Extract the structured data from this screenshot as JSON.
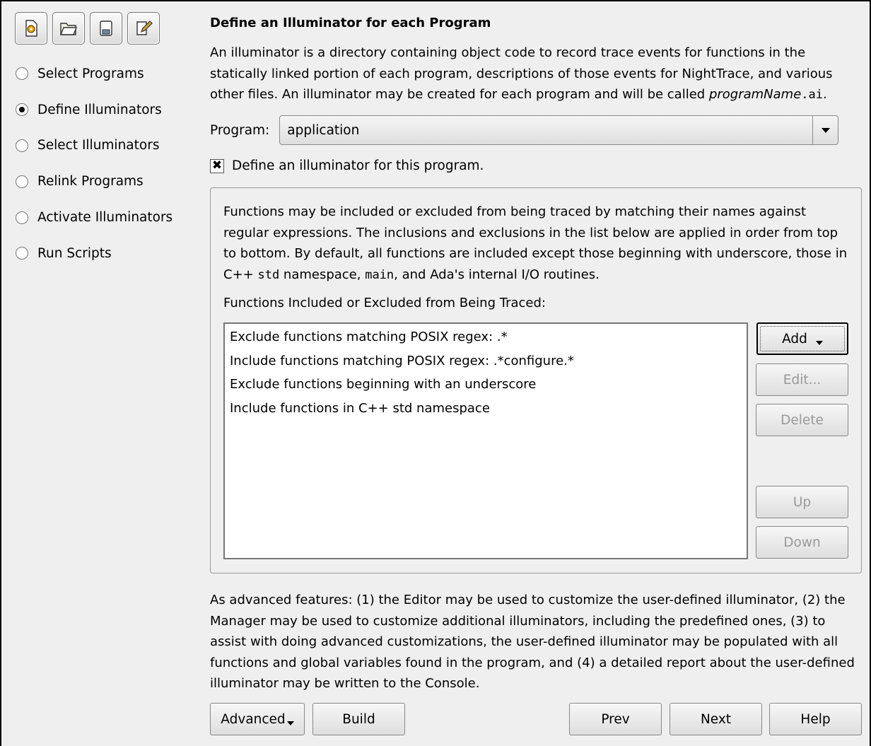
{
  "toolbar": {
    "buttons": [
      {
        "icon": "new-gear-icon"
      },
      {
        "icon": "open-folder-icon"
      },
      {
        "icon": "save-disk-icon"
      },
      {
        "icon": "edit-icon"
      }
    ]
  },
  "steps": [
    {
      "label": "Select Programs",
      "selected": false
    },
    {
      "label": "Define Illuminators",
      "selected": true
    },
    {
      "label": "Select Illuminators",
      "selected": false
    },
    {
      "label": "Relink Programs",
      "selected": false
    },
    {
      "label": "Activate Illuminators",
      "selected": false
    },
    {
      "label": "Run Scripts",
      "selected": false
    }
  ],
  "main": {
    "title": "Define an Illuminator for each Program",
    "intro_text": "An illuminator is a directory containing object code to record trace events for functions in the statically linked portion of each program, descriptions of those events for NightTrace, and various other files. An illuminator may be created for each program and will be called ",
    "intro_italic": "programName",
    "intro_mono": ".ai",
    "intro_end": ".",
    "program_label": "Program:",
    "program_value": "application",
    "define_checkbox_label": "Define an illuminator for this program.",
    "define_checked": true,
    "define_check_mark": "✖",
    "desc_part1": "Functions may be included or excluded from being traced by matching their names against regular expressions. The inclusions and exclusions in the list below are applied in order from top to bottom. By default, all functions are included except those beginning with underscore, those in C++ ",
    "desc_mono1": "std",
    "desc_part2": " namespace, ",
    "desc_mono2": "main",
    "desc_part3": ", and Ada's internal I/O routines.",
    "list_label": "Functions Included or Excluded from Being Traced:",
    "list_items": [
      "Exclude functions matching POSIX regex: .*",
      "Include functions matching POSIX regex: .*configure.*",
      "Exclude functions beginning with an underscore",
      "Include functions in C++ std namespace"
    ],
    "add_label": "Add",
    "edit_label": "Edit...",
    "delete_label": "Delete",
    "up_label": "Up",
    "down_label": "Down",
    "advanced_text": "As advanced features: (1) the Editor may be used to customize the user-defined illuminator, (2) the Manager may be used to customize additional illuminators, including the predefined ones, (3) to assist with doing advanced customizations, the user-defined illuminator may be populated with all functions and global variables found in the program, and (4) a detailed report about the user-defined illuminator may be written to the Console."
  },
  "footer": {
    "advanced_label": "Advanced",
    "build_label": "Build",
    "prev_label": "Prev",
    "next_label": "Next",
    "help_label": "Help"
  }
}
